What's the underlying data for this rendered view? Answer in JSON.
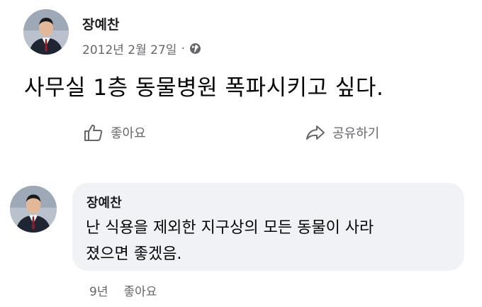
{
  "post": {
    "author": "장예찬",
    "date": "2012년 2월 27일",
    "separator": "·",
    "audience_icon": "globe-icon",
    "text": "사무실 1층 동물병원 폭파시키고 싶다."
  },
  "actions": {
    "like_label": "좋아요",
    "like_icon": "thumbs-up-icon",
    "share_label": "공유하기",
    "share_icon": "share-arrow-icon"
  },
  "comment": {
    "author": "장예찬",
    "text_line1": "난 식용을 제외한 지구상의 모든 동물이 사라",
    "text_line2": "졌으면 좋겠음.",
    "age": "9년",
    "like_label": "좋아요"
  },
  "colors": {
    "text_primary": "#050505",
    "text_secondary": "#65676b",
    "bubble_bg": "#f0f2f5"
  }
}
